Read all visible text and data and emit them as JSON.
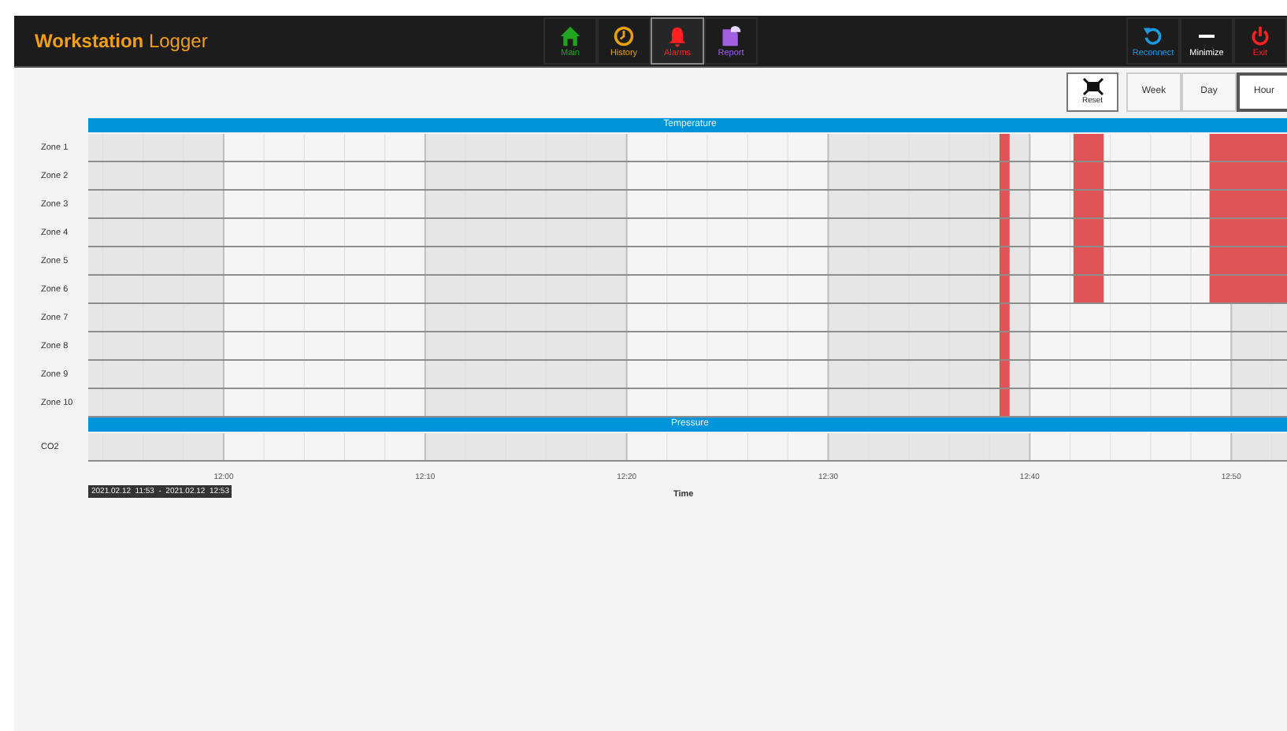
{
  "header": {
    "title": "**Workstation** Logger",
    "nav": [
      {
        "kind": "home",
        "label": "Main",
        "color": "#1fa51f",
        "selected": false
      },
      {
        "kind": "clock",
        "label": "History",
        "color": "#e8a010",
        "selected": false
      },
      {
        "kind": "bell",
        "label": "Alarms",
        "color": "#ff2020",
        "selected": true
      },
      {
        "kind": "report",
        "label": "Report",
        "color": "#a060e0",
        "selected": false
      }
    ],
    "actions": [
      {
        "kind": "reconnect",
        "label": "Reconnect",
        "color": "#1a9be0"
      },
      {
        "kind": "minimize",
        "label": "Minimize",
        "color": "#ffffff"
      },
      {
        "kind": "exit",
        "label": "Exit",
        "color": "#ff2020"
      }
    ]
  },
  "toolbar": {
    "reset": {
      "label": "Reset"
    },
    "ranges": [
      {
        "label": "Week",
        "selected": false
      },
      {
        "label": "Day",
        "selected": false
      },
      {
        "label": "Hour",
        "selected": true
      }
    ]
  },
  "timeline": {
    "sections": [
      {
        "title": "Temperature",
        "rows": [
          "Zone 1",
          "Zone 2",
          "Zone 3",
          "Zone 4",
          "Zone 5",
          "Zone 6",
          "Zone 7",
          "Zone 8",
          "Zone 9",
          "Zone 10"
        ]
      },
      {
        "title": "Pressure",
        "rows": [
          "CO2"
        ]
      }
    ],
    "ticks": [
      "12:00",
      "12:10",
      "12:20",
      "12:30",
      "12:40",
      "12:50"
    ],
    "axis_title": "Time",
    "range": "2021.02.12  11:53  -  2021.02.12  12:53"
  }
}
